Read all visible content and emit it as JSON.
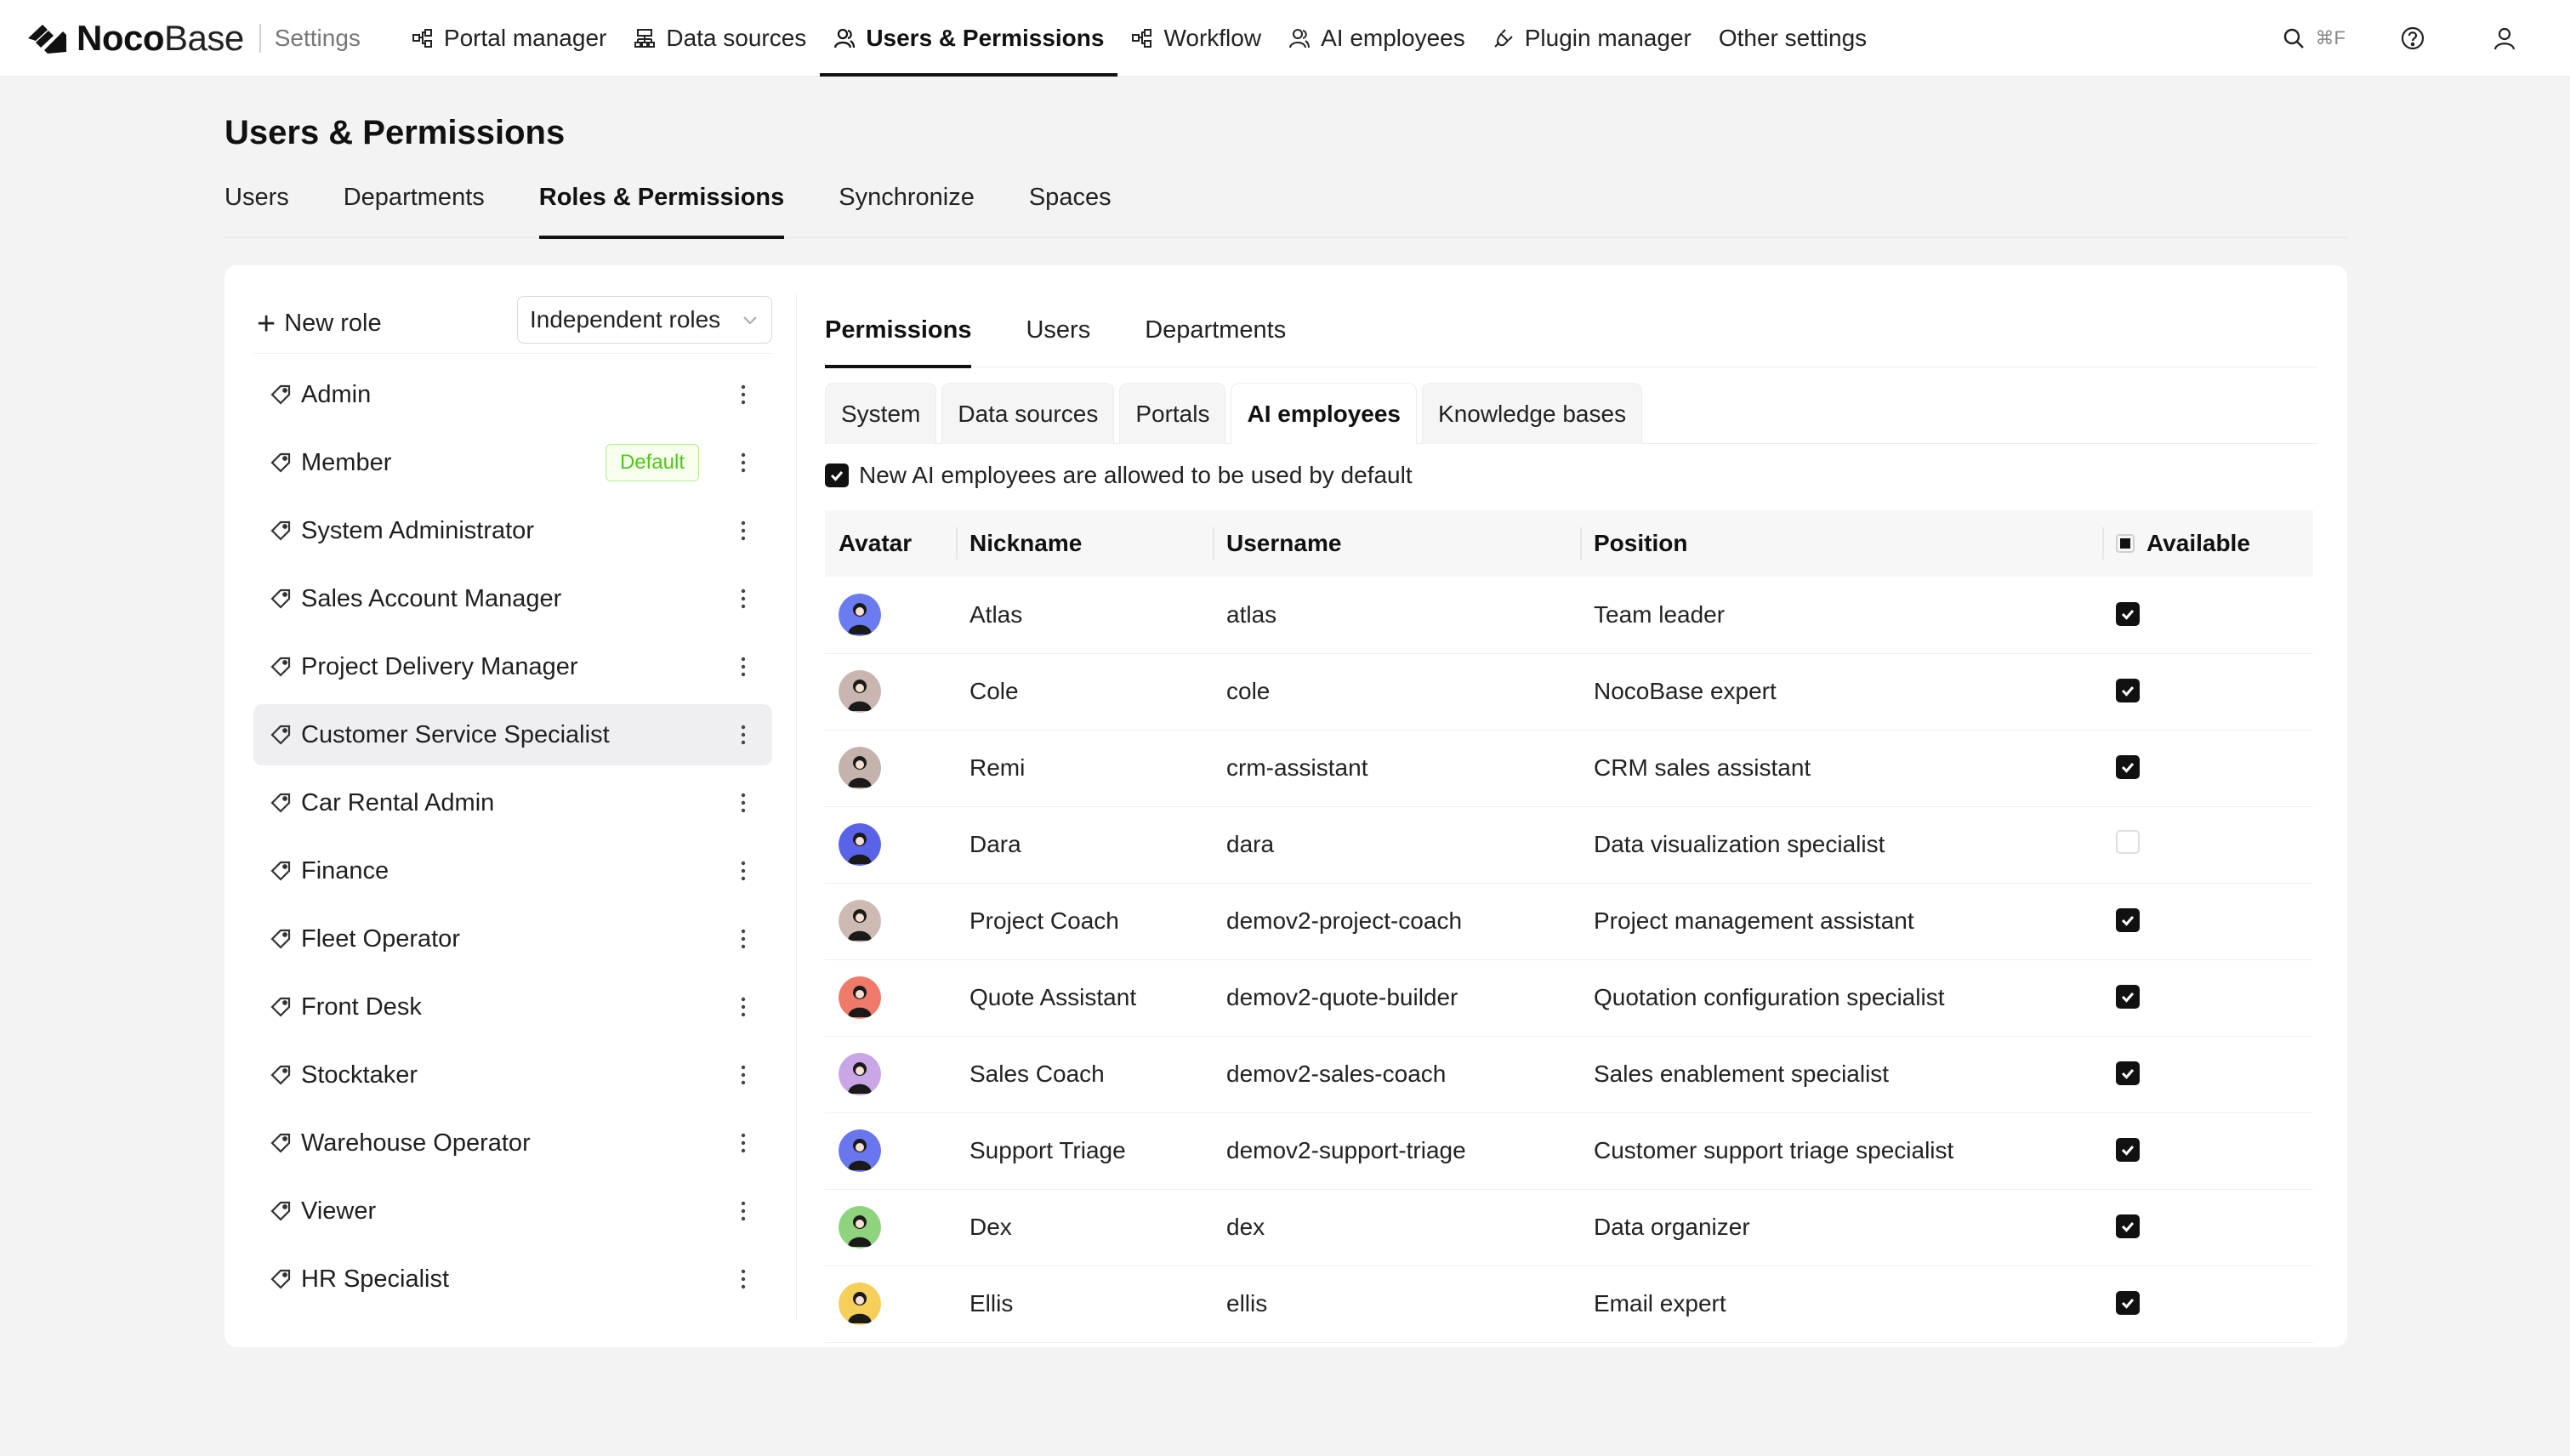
{
  "header": {
    "brand_bold": "Noco",
    "brand_light": "Base",
    "section": "Settings",
    "nav": [
      {
        "label": "Portal manager",
        "icon": "portal-icon"
      },
      {
        "label": "Data sources",
        "icon": "database-icon"
      },
      {
        "label": "Users & Permissions",
        "icon": "users-icon",
        "active": true
      },
      {
        "label": "Workflow",
        "icon": "workflow-icon"
      },
      {
        "label": "AI employees",
        "icon": "ai-employee-icon"
      },
      {
        "label": "Plugin manager",
        "icon": "plugin-icon"
      },
      {
        "label": "Other settings",
        "icon": ""
      }
    ],
    "search_shortcut": "⌘F"
  },
  "page": {
    "title": "Users & Permissions",
    "tabs": [
      "Users",
      "Departments",
      "Roles & Permissions",
      "Synchronize",
      "Spaces"
    ],
    "active_tab": "Roles & Permissions"
  },
  "roles_panel": {
    "new_role_label": "New role",
    "mode_select": "Independent roles",
    "roles": [
      {
        "name": "Admin"
      },
      {
        "name": "Member",
        "badge": "Default"
      },
      {
        "name": "System Administrator"
      },
      {
        "name": "Sales Account Manager"
      },
      {
        "name": "Project Delivery Manager"
      },
      {
        "name": "Customer Service Specialist",
        "selected": true
      },
      {
        "name": "Car Rental Admin"
      },
      {
        "name": "Finance"
      },
      {
        "name": "Fleet Operator"
      },
      {
        "name": "Front Desk"
      },
      {
        "name": "Stocktaker"
      },
      {
        "name": "Warehouse Operator"
      },
      {
        "name": "Viewer"
      },
      {
        "name": "HR Specialist"
      }
    ]
  },
  "permissions": {
    "tabs": [
      "Permissions",
      "Users",
      "Departments"
    ],
    "active_tab": "Permissions",
    "category_tabs": [
      "System",
      "Data sources",
      "Portals",
      "AI employees",
      "Knowledge bases"
    ],
    "active_category": "AI employees",
    "default_checkbox_label": "New AI employees are allowed to be used by default",
    "table": {
      "columns": [
        "Avatar",
        "Nickname",
        "Username",
        "Position",
        "Available"
      ],
      "rows": [
        {
          "nickname": "Atlas",
          "username": "atlas",
          "position": "Team leader",
          "available": true,
          "avatar_color": "#6b7cf0"
        },
        {
          "nickname": "Cole",
          "username": "cole",
          "position": "NocoBase expert",
          "available": true,
          "avatar_color": "#c9b6b0"
        },
        {
          "nickname": "Remi",
          "username": "crm-assistant",
          "position": "CRM sales assistant",
          "available": true,
          "avatar_color": "#c4b2ac"
        },
        {
          "nickname": "Dara",
          "username": "dara",
          "position": "Data visualization specialist",
          "available": false,
          "avatar_color": "#5a63e8"
        },
        {
          "nickname": "Project Coach",
          "username": "demov2-project-coach",
          "position": "Project management assistant",
          "available": true,
          "avatar_color": "#cdbbb3"
        },
        {
          "nickname": "Quote Assistant",
          "username": "demov2-quote-builder",
          "position": "Quotation configuration specialist",
          "available": true,
          "avatar_color": "#f07a6a"
        },
        {
          "nickname": "Sales Coach",
          "username": "demov2-sales-coach",
          "position": "Sales enablement specialist",
          "available": true,
          "avatar_color": "#c9a6e6"
        },
        {
          "nickname": "Support Triage",
          "username": "demov2-support-triage",
          "position": "Customer support triage specialist",
          "available": true,
          "avatar_color": "#6a76ee"
        },
        {
          "nickname": "Dex",
          "username": "dex",
          "position": "Data organizer",
          "available": true,
          "avatar_color": "#8fd37f"
        },
        {
          "nickname": "Ellis",
          "username": "ellis",
          "position": "Email expert",
          "available": true,
          "avatar_color": "#f5cf5a"
        }
      ]
    }
  }
}
